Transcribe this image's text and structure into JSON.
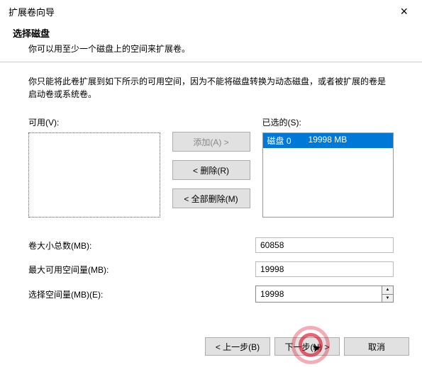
{
  "window": {
    "title": "扩展卷向导"
  },
  "header": {
    "title": "选择磁盘",
    "desc": "你可以用至少一个磁盘上的空间来扩展卷。"
  },
  "intro": "你只能将此卷扩展到如下所示的可用空间，因为不能将磁盘转换为动态磁盘，或者被扩展的卷是启动卷或系统卷。",
  "labels": {
    "available": "可用(V):",
    "selected": "已选的(S):"
  },
  "buttons": {
    "add": "添加(A)  >",
    "remove": "<  删除(R)",
    "removeAll": "<  全部删除(M)",
    "back": "< 上一步(B)",
    "next": "下一步(N) >",
    "cancel": "取消"
  },
  "selectedDisk": {
    "name": "磁盘 0",
    "size": "19998 MB"
  },
  "fields": {
    "totalLabel": "卷大小总数(MB):",
    "totalValue": "60858",
    "maxAvailLabel": "最大可用空间量(MB):",
    "maxAvailValue": "19998",
    "selectAmtLabel": "选择空间量(MB)(E):",
    "selectAmtValue": "19998"
  }
}
